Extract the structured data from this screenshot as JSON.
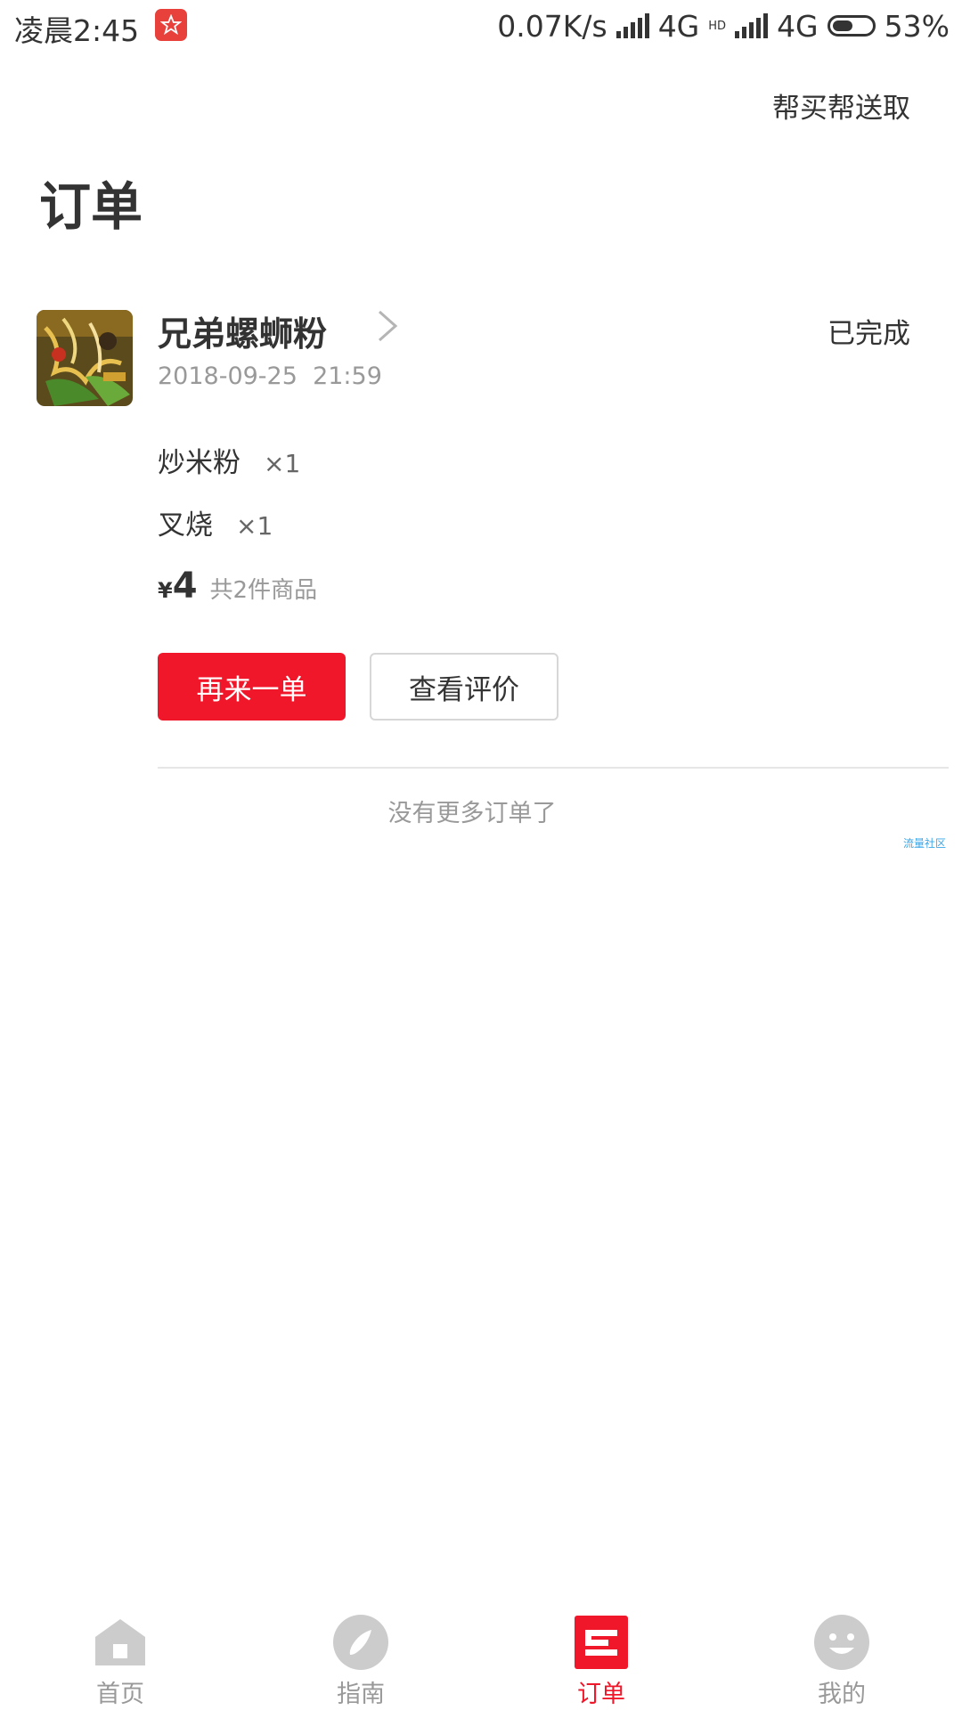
{
  "status_bar": {
    "time": "凌晨2:45",
    "network_speed": "0.07K/s",
    "network_1": "4G",
    "network_2_badge": "HD",
    "network_2": "4G",
    "battery_percent": "53%",
    "battery_level": 0.53,
    "app_icon": "star-badge-icon"
  },
  "header": {
    "top_link": "帮买帮送取",
    "title": "订单"
  },
  "order": {
    "shop_name": "兄弟螺蛳粉",
    "status": "已完成",
    "time": "2018-09-25  21:59",
    "items": [
      {
        "name": "炒米粉",
        "qty": "×1"
      },
      {
        "name": "叉烧",
        "qty": "×1"
      }
    ],
    "currency": "¥",
    "price": "4",
    "count_text": "共2件商品",
    "reorder_label": "再来一单",
    "review_label": "查看评价"
  },
  "footer_text": "没有更多订单了",
  "watermark": "流量社区",
  "tabs": [
    {
      "label": "首页",
      "icon": "home-icon",
      "active": false
    },
    {
      "label": "指南",
      "icon": "compass-icon",
      "active": false
    },
    {
      "label": "订单",
      "icon": "order-icon",
      "active": true
    },
    {
      "label": "我的",
      "icon": "profile-face-icon",
      "active": false
    }
  ],
  "colors": {
    "accent": "#f0172a",
    "inactive_icon": "#cccccc",
    "text_primary": "#333333",
    "text_secondary": "#999999"
  }
}
